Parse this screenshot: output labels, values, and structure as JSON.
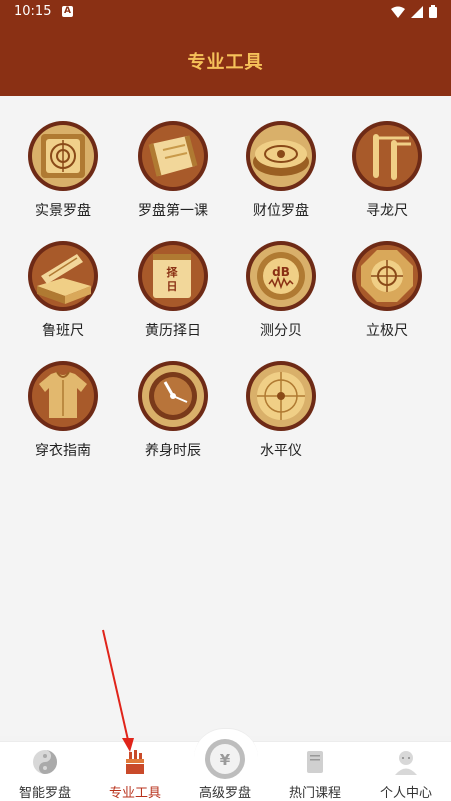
{
  "status_bar": {
    "time": "10:15",
    "notification_letter": "A"
  },
  "header": {
    "title": "专业工具"
  },
  "tools": [
    {
      "label": "实景罗盘",
      "icon": "compass-grid-icon"
    },
    {
      "label": "罗盘第一课",
      "icon": "scroll-icon"
    },
    {
      "label": "财位罗盘",
      "icon": "round-compass-icon"
    },
    {
      "label": "寻龙尺",
      "icon": "dowsing-rod-icon"
    },
    {
      "label": "鲁班尺",
      "icon": "ruler-icon"
    },
    {
      "label": "黄历择日",
      "icon": "calendar-icon"
    },
    {
      "label": "测分贝",
      "icon": "decibel-icon"
    },
    {
      "label": "立极尺",
      "icon": "octagon-compass-icon"
    },
    {
      "label": "穿衣指南",
      "icon": "clothing-icon"
    },
    {
      "label": "养身时辰",
      "icon": "clock-icon"
    },
    {
      "label": "水平仪",
      "icon": "level-icon"
    }
  ],
  "bottom_nav": [
    {
      "label": "智能罗盘",
      "icon": "yin-yang-icon"
    },
    {
      "label": "专业工具",
      "icon": "tools-icon",
      "active": true
    },
    {
      "label": "高级罗盘",
      "icon": "yuan-coin-icon"
    },
    {
      "label": "热门课程",
      "icon": "book-icon"
    },
    {
      "label": "个人中心",
      "icon": "person-icon"
    }
  ],
  "calendar_icon_text": "择日",
  "decibel_icon_text": "dB",
  "yuan_symbol": "¥",
  "colors": {
    "header": "#8a3014",
    "title": "#f6c25a",
    "active_nav": "#b8331d",
    "icon_ring": "#6e2a16",
    "gold": "#c99a4a"
  }
}
